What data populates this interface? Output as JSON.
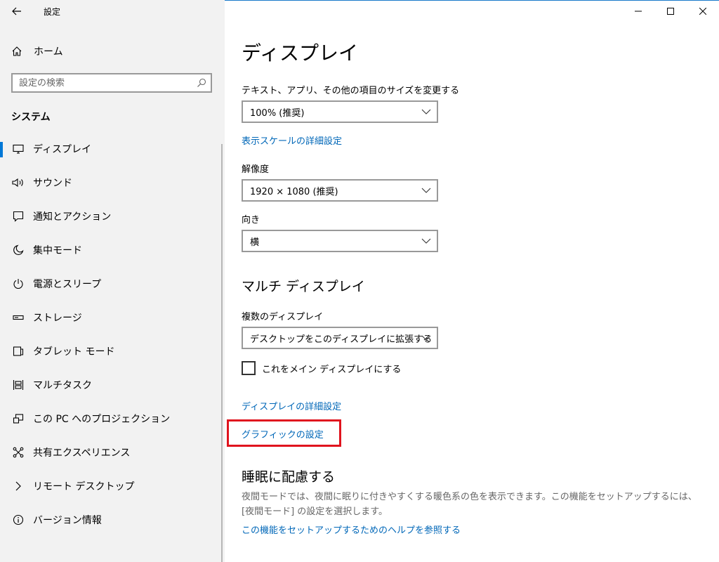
{
  "window": {
    "title": "設定"
  },
  "sidebar": {
    "home_label": "ホーム",
    "search_placeholder": "設定の検索",
    "section_title": "システム",
    "items": [
      {
        "label": "ディスプレイ",
        "icon": "monitor-icon",
        "active": true
      },
      {
        "label": "サウンド",
        "icon": "speaker-icon"
      },
      {
        "label": "通知とアクション",
        "icon": "notification-icon"
      },
      {
        "label": "集中モード",
        "icon": "moon-icon"
      },
      {
        "label": "電源とスリープ",
        "icon": "power-icon"
      },
      {
        "label": "ストレージ",
        "icon": "storage-icon"
      },
      {
        "label": "タブレット モード",
        "icon": "tablet-icon"
      },
      {
        "label": "マルチタスク",
        "icon": "multitask-icon"
      },
      {
        "label": "この PC へのプロジェクション",
        "icon": "projection-icon"
      },
      {
        "label": "共有エクスペリエンス",
        "icon": "share-icon"
      },
      {
        "label": "リモート デスクトップ",
        "icon": "remote-icon"
      },
      {
        "label": "バージョン情報",
        "icon": "info-icon"
      }
    ]
  },
  "main": {
    "title": "ディスプレイ",
    "scale_label": "テキスト、アプリ、その他の項目のサイズを変更する",
    "scale_value": "100% (推奨)",
    "scale_link": "表示スケールの詳細設定",
    "resolution_label": "解像度",
    "resolution_value": "1920 × 1080 (推奨)",
    "orientation_label": "向き",
    "orientation_value": "横",
    "multi_title": "マルチ ディスプレイ",
    "multi_label": "複数のディスプレイ",
    "multi_value": "デスクトップをこのディスプレイに拡張する",
    "main_display_label": "これをメイン ディスプレイにする",
    "advanced_link": "ディスプレイの詳細設定",
    "graphics_link": "グラフィックの設定",
    "sleep_title": "睡眠に配慮する",
    "sleep_desc": "夜間モードでは、夜間に眠りに付きやすくする暖色系の色を表示できます。この機能をセットアップするには、[夜間モード] の設定を選択します。",
    "help_link": "この機能をセットアップするためのヘルプを参照する"
  },
  "colors": {
    "accent": "#0078d7",
    "link": "#0067b8",
    "highlight": "#e0141e",
    "sidebar_bg": "#f2f2f2"
  }
}
